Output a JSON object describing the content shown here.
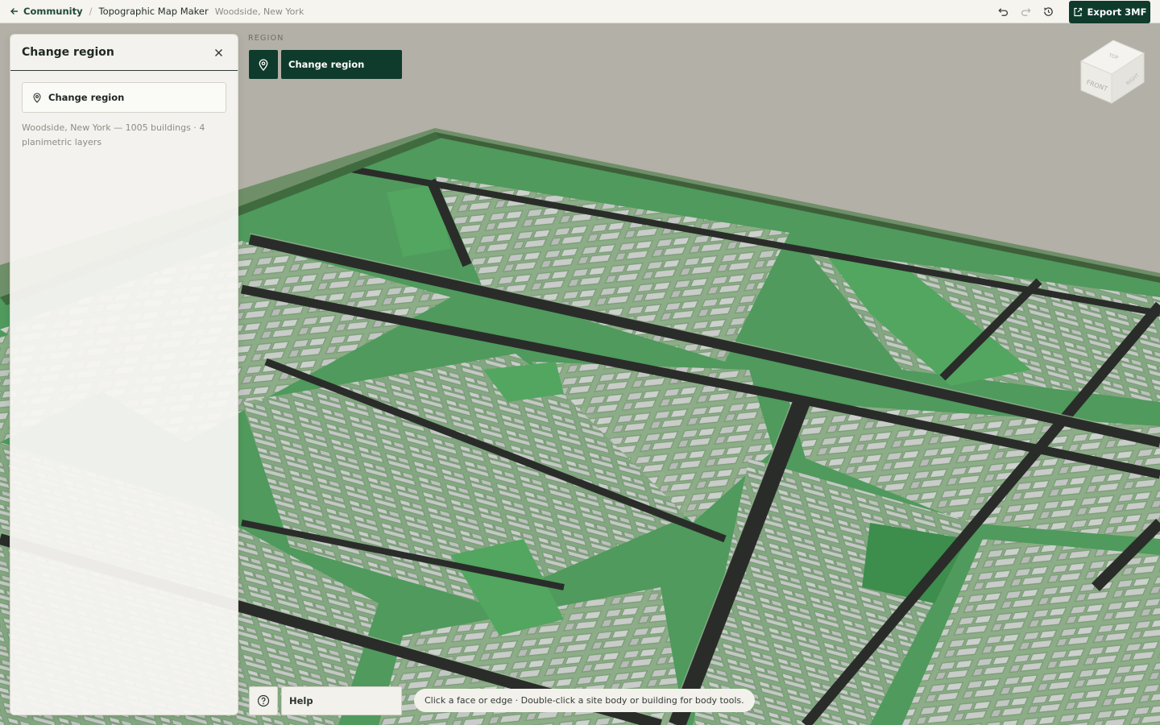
{
  "breadcrumb": {
    "back_label": "Community",
    "separator": "/",
    "app_name": "Topographic Map Maker",
    "location": "Woodside, New York"
  },
  "toolbar": {
    "undo_icon": "undo-icon",
    "redo_icon": "redo-icon",
    "history_icon": "history-icon",
    "export_label": "Export 3MF",
    "export_icon": "export-icon"
  },
  "panel": {
    "title": "Change region",
    "region_button_label": "Change region",
    "info": "Woodside, New York — 1005 buildings · 4 planimetric layers"
  },
  "region_chip": {
    "section_label": "REGION",
    "button_label": "Change region"
  },
  "view_cube": {
    "top": "TOP",
    "front": "FRONT",
    "right": "RIGHT"
  },
  "help": {
    "label": "Help"
  },
  "hint": {
    "text": "Click a face or edge · Double-click a site body or building for body tools."
  },
  "colors": {
    "accent": "#0f3b2c",
    "terrain_green": "#4f9a5c",
    "building_edge": "#7f9e7a",
    "road": "#2a2c2a",
    "background": "#b3b0a7"
  }
}
